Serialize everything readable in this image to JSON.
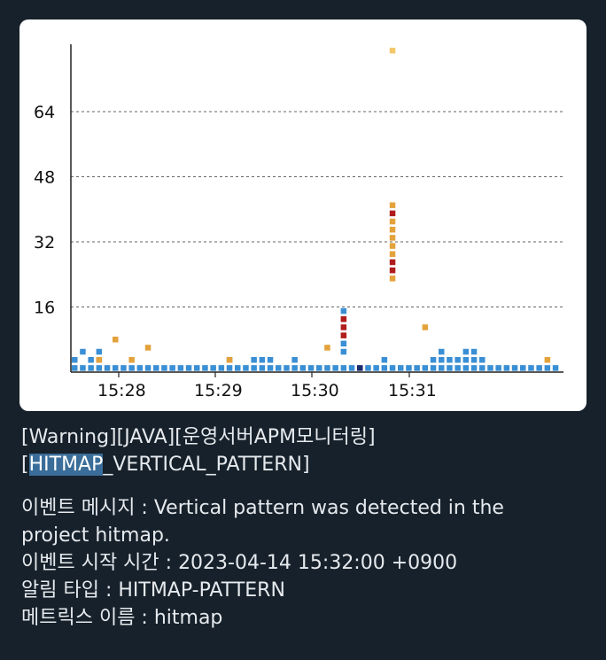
{
  "message": {
    "title_line1": "[Warning][JAVA][운영서버APM모니터링]",
    "title_highlight": "HITMAP",
    "title_line2_rest": "_VERTICAL_PATTERN]",
    "title_line2_open": "[",
    "event_message": "이벤트 메시지 : Vertical pattern was detected in the",
    "event_message_cont": "project hitmap.",
    "start_time": "이벤트 시작 시간 : 2023-04-14 15:32:00 +0900",
    "alert_type": "알림 타입 : HITMAP-PATTERN",
    "metric_name": "메트릭스 이름 : hitmap"
  },
  "chart_data": {
    "type": "heatmap",
    "title": "",
    "xlabel": "",
    "ylabel": "",
    "x_ticks": [
      "15:28",
      "15:29",
      "15:30",
      "15:31"
    ],
    "y_ticks": [
      16,
      32,
      48,
      64
    ],
    "ylim": [
      0,
      80
    ],
    "grid": "horizontal dashed",
    "colors": {
      "low": "#3a8fd4",
      "mid": "#e3a23b",
      "high": "#b01c1c",
      "dark": "#1b2a6b",
      "top": "#f3c86a"
    },
    "column_cells": [
      [
        1,
        "low"
      ],
      [
        1,
        "low"
      ],
      [
        1,
        "low"
      ],
      [
        1,
        "low"
      ],
      [
        1,
        "low"
      ],
      [
        1,
        "low"
      ],
      [
        1,
        "low"
      ],
      [
        1,
        "low"
      ],
      [
        1,
        "low"
      ],
      [
        1,
        "low"
      ]
    ]
  }
}
